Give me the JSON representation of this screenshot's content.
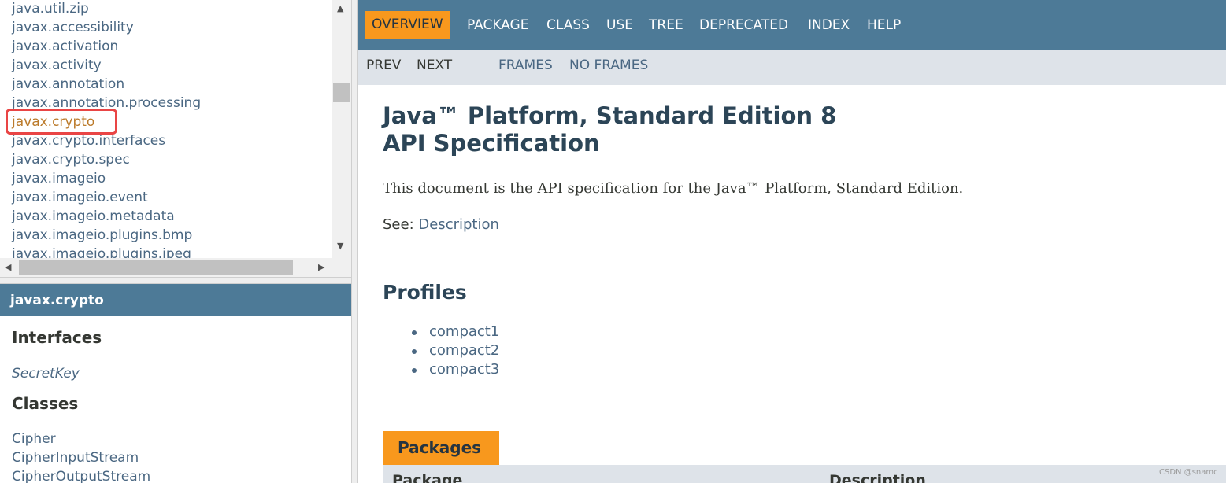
{
  "package_frame": {
    "packages": [
      "java.util.zip",
      "javax.accessibility",
      "javax.activation",
      "javax.activity",
      "javax.annotation",
      "javax.annotation.processing",
      "javax.crypto",
      "javax.crypto.interfaces",
      "javax.crypto.spec",
      "javax.imageio",
      "javax.imageio.event",
      "javax.imageio.metadata",
      "javax.imageio.plugins.bmp",
      "javax.imageio.plugins.jpeg"
    ],
    "selected_package": "javax.crypto",
    "icons": {
      "scroll_up": "triangle-up-icon",
      "scroll_down": "triangle-down-icon",
      "scroll_left": "triangle-left-icon",
      "scroll_right": "triangle-right-icon"
    }
  },
  "class_frame": {
    "title": "javax.crypto",
    "interfaces_heading": "Interfaces",
    "interfaces": [
      "SecretKey"
    ],
    "classes_heading": "Classes",
    "classes": [
      "Cipher",
      "CipherInputStream",
      "CipherOutputStream"
    ]
  },
  "top_nav": {
    "overview": "OVERVIEW",
    "package": "PACKAGE",
    "class": "CLASS",
    "use": "USE",
    "tree": "TREE",
    "deprecated": "DEPRECATED",
    "index": "INDEX",
    "help": "HELP"
  },
  "sub_nav": {
    "prev": "PREV",
    "next": "NEXT",
    "frames": "FRAMES",
    "no_frames": "NO FRAMES"
  },
  "main": {
    "title_line1": "Java™ Platform, Standard Edition 8",
    "title_line2": "API Specification",
    "intro": "This document is the API specification for the Java™ Platform, Standard Edition.",
    "see_label": "See:",
    "see_link": "Description",
    "profiles_heading": "Profiles",
    "profiles": [
      "compact1",
      "compact2",
      "compact3"
    ],
    "packages_tab": "Packages",
    "table_headers": {
      "package": "Package",
      "description": "Description"
    }
  },
  "watermark": "CSDN @snamc",
  "colors": {
    "nav_bg": "#4d7a97",
    "active_tab": "#f8981d",
    "subnav_bg": "#dee3e9",
    "link": "#4a6782",
    "selected_link": "#bb7a2a",
    "selection_outline": "#e94545"
  }
}
